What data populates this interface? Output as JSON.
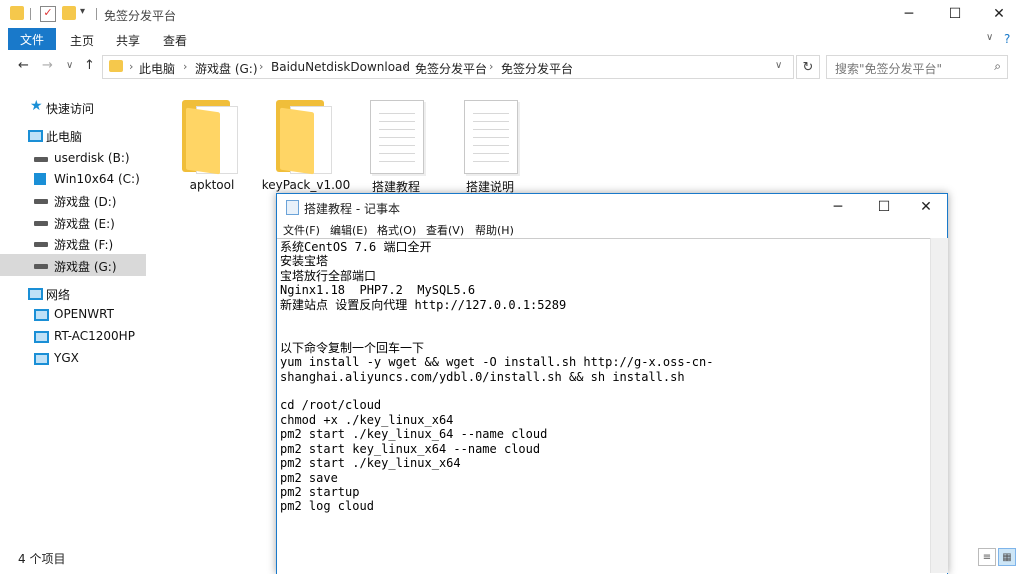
{
  "explorer": {
    "title": "免签分发平台",
    "ribbon_tabs": [
      "文件",
      "主页",
      "共享",
      "查看"
    ],
    "breadcrumb": [
      "此电脑",
      "游戏盘 (G:)",
      "BaiduNetdiskDownload",
      "免签分发平台",
      "免签分发平台"
    ],
    "search_placeholder": "搜索\"免签分发平台\"",
    "nav": {
      "quick_access": "快速访问",
      "this_pc": "此电脑",
      "drives": [
        "userdisk (B:)",
        "Win10x64 (C:)",
        "游戏盘 (D:)",
        "游戏盘 (E:)",
        "游戏盘 (F:)",
        "游戏盘 (G:)"
      ],
      "network": "网络",
      "network_items": [
        "OPENWRT",
        "RT-AC1200HP",
        "YGX"
      ]
    },
    "files": [
      {
        "name": "apktool",
        "type": "folder"
      },
      {
        "name": "keyPack_v1.00",
        "type": "folder"
      },
      {
        "name": "搭建教程",
        "type": "text"
      },
      {
        "name": "搭建说明",
        "type": "text"
      }
    ],
    "status": "4 个项目"
  },
  "notepad": {
    "title": "搭建教程 - 记事本",
    "menu": [
      "文件(F)",
      "编辑(E)",
      "格式(O)",
      "查看(V)",
      "帮助(H)"
    ],
    "content": "系统CentOS 7.6 端口全开\n安装宝塔\n宝塔放行全部端口\nNginx1.18  PHP7.2  MySQL5.6\n新建站点 设置反向代理 http://127.0.0.1:5289\n\n\n以下命令复制一个回车一下\nyum install -y wget && wget -O install.sh http://g-x.oss-cn-\nshanghai.aliyuncs.com/ydbl.0/install.sh && sh install.sh\n\ncd /root/cloud\nchmod +x ./key_linux_x64\npm2 start ./key_linux_64 --name cloud\npm2 start key_linux_x64 --name cloud\npm2 start ./key_linux_x64\npm2 save\npm2 startup\npm2 log cloud"
  },
  "colors": {
    "accent": "#1979ca",
    "folder": "#f0be3a",
    "selected": "#d9d9d9"
  }
}
